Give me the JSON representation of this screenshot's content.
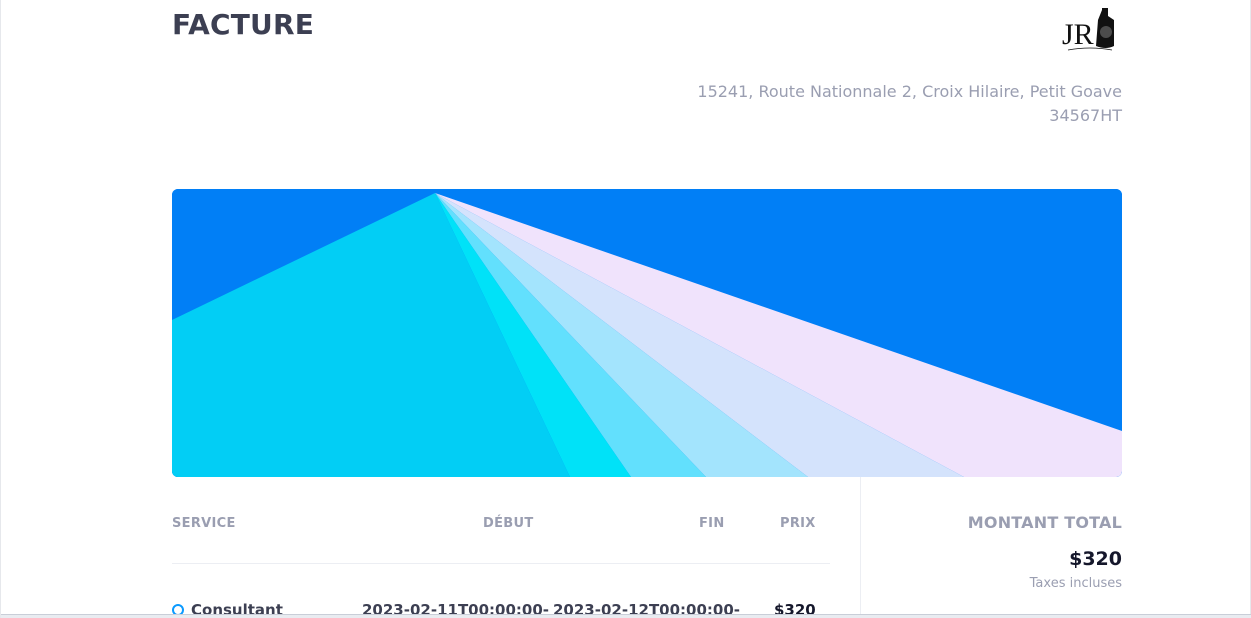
{
  "invoice": {
    "title": "FACTURE",
    "logo_text": "JR"
  },
  "address": {
    "line1": "15241, Route Nationnale 2, Croix Hilaire, Petit Goave",
    "line2": "34567HT"
  },
  "table": {
    "headers": {
      "service": "SERVICE",
      "debut": "DÉBUT",
      "fin": "FIN",
      "prix": "PRIX"
    },
    "rows": [
      {
        "service": "Consultant",
        "debut": "2023-02-11T00:00:00-",
        "fin": "2023-02-12T00:00:00-",
        "prix": "$320"
      }
    ]
  },
  "total": {
    "label": "MONTANT TOTAL",
    "value": "$320",
    "note": "Taxes incluses"
  },
  "colors": {
    "banner_bg": "#017ff6",
    "accent": "#0b9aff",
    "heading": "#3c3f52",
    "muted": "#9a9eb1"
  }
}
